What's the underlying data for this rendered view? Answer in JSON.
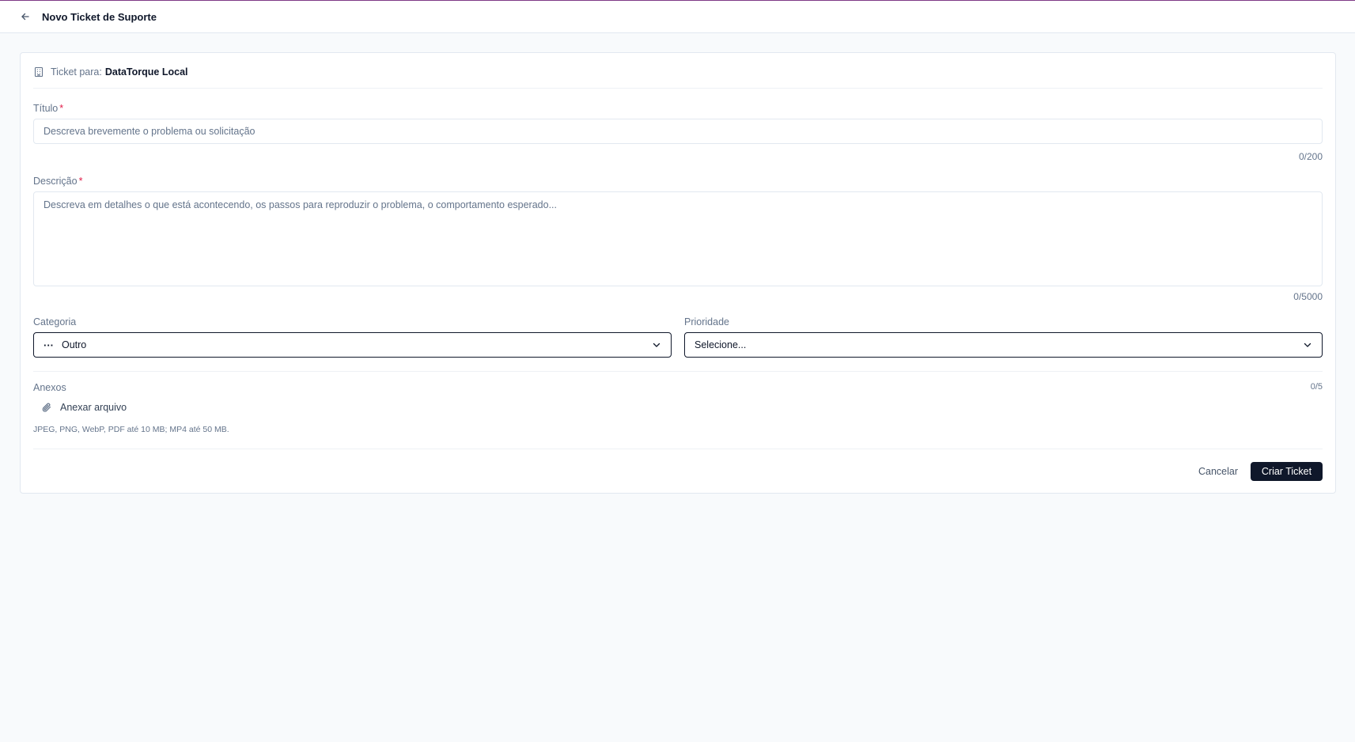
{
  "header": {
    "title": "Novo Ticket de Suporte",
    "back_icon": "arrow-left-icon"
  },
  "ticket_for": {
    "label": "Ticket para:",
    "organization": "DataTorque Local",
    "icon": "building-icon"
  },
  "form": {
    "title": {
      "label": "Título",
      "required_mark": "*",
      "placeholder": "Descreva brevemente o problema ou solicitação",
      "value": "",
      "counter": "0/200"
    },
    "description": {
      "label": "Descrição",
      "required_mark": "*",
      "placeholder": "Descreva em detalhes o que está acontecendo, os passos para reproduzir o problema, o comportamento esperado...",
      "value": "",
      "counter": "0/5000"
    },
    "category": {
      "label": "Categoria",
      "selected": "Outro",
      "icon": "more-horizontal-icon"
    },
    "priority": {
      "label": "Prioridade",
      "selected": "Selecione..."
    },
    "attachments": {
      "label": "Anexos",
      "counter": "0/5",
      "attach_label": "Anexar arquivo",
      "attach_icon": "paperclip-icon",
      "hint": "JPEG, PNG, WebP, PDF até 10 MB; MP4 até 50 MB."
    }
  },
  "actions": {
    "cancel_label": "Cancelar",
    "submit_label": "Criar Ticket"
  },
  "colors": {
    "accent_topline": "#7e3a86",
    "primary_button": "#0f172a",
    "required": "#e11d48",
    "background": "#f8fafc"
  }
}
